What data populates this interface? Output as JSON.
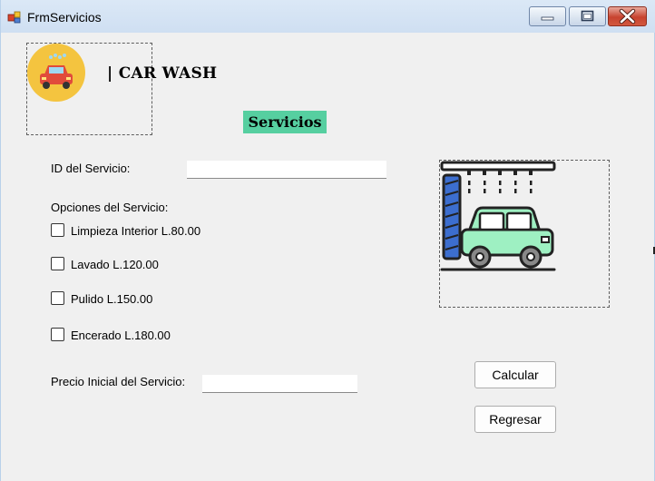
{
  "window": {
    "title": "FrmServicios",
    "icon": "app-form-icon",
    "controls": [
      "minimize-icon",
      "maximize-icon",
      "close-icon"
    ]
  },
  "header": {
    "logo": "car-wash-logo",
    "brand_text": "| CAR WASH",
    "section_title": "Servicios",
    "section_color": "#56cfa0"
  },
  "form": {
    "id_label": "ID del Servicio:",
    "id_value": "",
    "options_label": "Opciones del Servicio:",
    "options": [
      {
        "label": "Limpieza Interior L.80.00",
        "checked": false
      },
      {
        "label": "Lavado L.120.00",
        "checked": false
      },
      {
        "label": "Pulido L.150.00",
        "checked": false
      },
      {
        "label": "Encerado L.180.00",
        "checked": false
      }
    ],
    "price_label": "Precio Inicial del Servicio:",
    "price_value": ""
  },
  "illustration": "car-wash-icon",
  "buttons": {
    "calcular": "Calcular",
    "regresar": "Regresar"
  }
}
